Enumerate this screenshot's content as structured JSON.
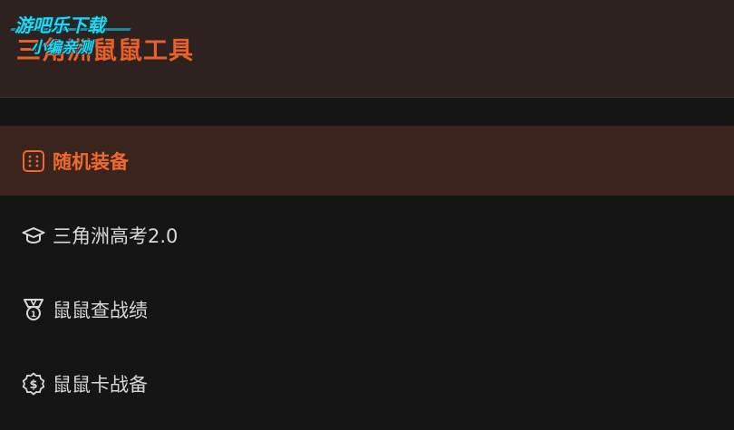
{
  "header": {
    "title": "三角洲鼠鼠工具"
  },
  "watermark": {
    "line1": "游吧乐下载",
    "line2": "小编亲测"
  },
  "menu": {
    "items": [
      {
        "label": "随机装备",
        "icon": "dice-icon",
        "active": true
      },
      {
        "label": "三角洲高考2.0",
        "icon": "graduation-cap-icon",
        "active": false
      },
      {
        "label": "鼠鼠查战绩",
        "icon": "medal-icon",
        "active": false
      },
      {
        "label": "鼠鼠卡战备",
        "icon": "dollar-coin-icon",
        "active": false
      }
    ]
  },
  "colors": {
    "accent": "#e8612a",
    "header_bg": "#2e2220",
    "active_bg": "#3c241e",
    "page_bg": "#151515",
    "text": "#d8d8d8",
    "watermark": "#28d6ee"
  }
}
